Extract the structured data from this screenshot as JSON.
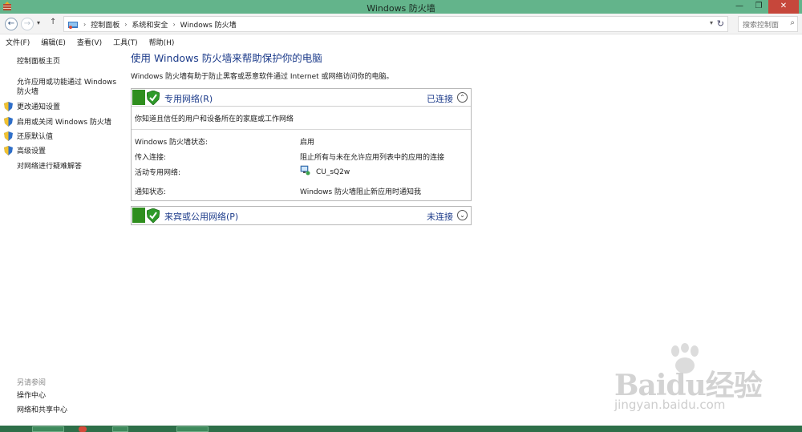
{
  "window": {
    "title": "Windows 防火墙",
    "app_icon": "firewall-app-icon"
  },
  "window_controls": {
    "minimize": "—",
    "maximize": "❐",
    "close": "✕"
  },
  "address_bar": {
    "back": "back-arrow-icon",
    "forward": "forward-arrow-icon",
    "recent": "▾",
    "up": "↑",
    "breadcrumbs": [
      "控制面板",
      "系统和安全",
      "Windows 防火墙"
    ],
    "separator": "›",
    "dropdown": "▾",
    "refresh": "↻",
    "search_placeholder": "搜索控制面",
    "search_icon": "⌕"
  },
  "menu": [
    "文件(F)",
    "编辑(E)",
    "查看(V)",
    "工具(T)",
    "帮助(H)"
  ],
  "left_nav": {
    "home": "控制面板主页",
    "allow_app": "允许应用或功能通过 Windows 防火墙",
    "change_notify": "更改通知设置",
    "toggle_firewall": "启用或关闭 Windows 防火墙",
    "restore_defaults": "还原默认值",
    "advanced": "高级设置",
    "troubleshoot": "对网络进行疑难解答",
    "see_also": "另请参阅",
    "action_center": "操作中心",
    "network_sharing": "网络和共享中心"
  },
  "main": {
    "heading": "使用 Windows 防火墙来帮助保护你的电脑",
    "description": "Windows 防火墙有助于防止黑客或恶意软件通过 Internet 或网络访问你的电脑。",
    "private": {
      "name": "专用网络(R)",
      "status": "已连接",
      "chevron": "⌃",
      "desc": "你知道且信任的用户和设备所在的家庭或工作网络",
      "rows": [
        {
          "label": "Windows 防火墙状态:",
          "value": "启用"
        },
        {
          "label": "传入连接:",
          "value": "阻止所有与未在允许应用列表中的应用的连接"
        },
        {
          "label": "活动专用网络:",
          "value": "CU_sQ2w"
        },
        {
          "label": "通知状态:",
          "value": "Windows 防火墙阻止新应用时通知我"
        }
      ]
    },
    "public": {
      "name": "来宾或公用网络(P)",
      "status": "未连接",
      "chevron": "⌄"
    }
  },
  "watermark": {
    "brand": "Baidu经验",
    "site": "jingyan.baidu.com"
  },
  "colors": {
    "titlebar": "#63b48b",
    "link_blue": "#1c3b8a",
    "shield_green": "#2f8e1e",
    "taskbar": "#2e6f49"
  }
}
